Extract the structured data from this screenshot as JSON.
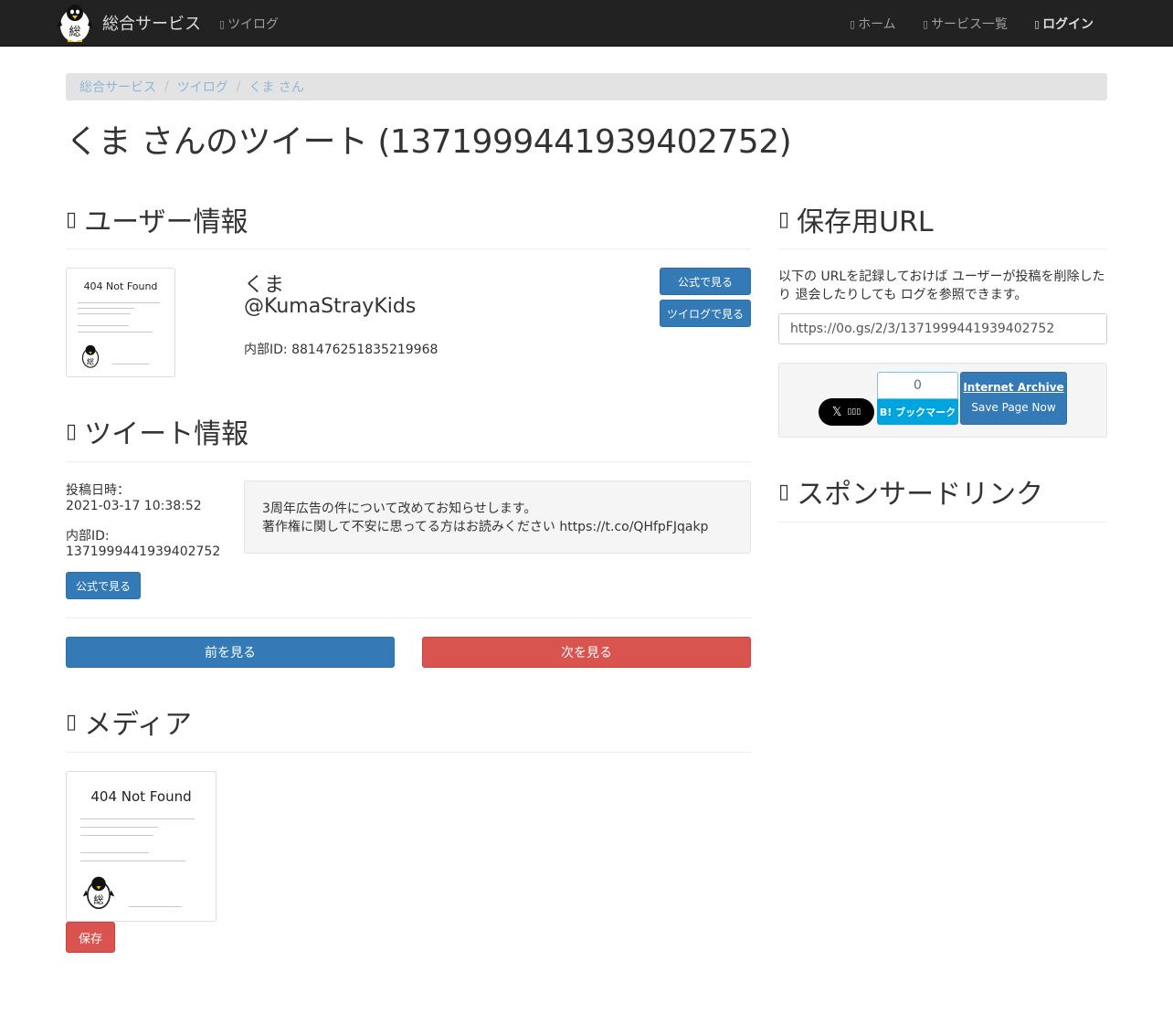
{
  "nav": {
    "brand": "総合サービス",
    "twilog": "ツイログ",
    "home": "ホーム",
    "services": "サービス一覧",
    "login": "ログイン"
  },
  "breadcrumb": [
    "総合サービス",
    "ツイログ",
    "くま さん"
  ],
  "page_title": "くま さんのツイート (1371999441939402752)",
  "user_section": {
    "heading": "ユーザー情報",
    "avatar_title": "404 Not Found",
    "name": "くま",
    "handle": "@KumaStrayKids",
    "internal_id": "内部ID: 881476251835219968",
    "btn_official": "公式で見る",
    "btn_twilog": "ツイログで見る"
  },
  "tweet_section": {
    "heading": "ツイート情報",
    "posted_label": "投稿日時：",
    "posted_value": "2021-03-17 10:38:52",
    "id_label": "内部ID:",
    "id_value": "1371999441939402752",
    "btn_official": "公式で見る",
    "line1": "3周年広告の件について改めてお知らせします。",
    "line2": "著作権に関して不安に思ってる方はお読みください https://t.co/QHfpFJqakp"
  },
  "pager": {
    "prev": "前を見る",
    "next": "次を見る"
  },
  "media_section": {
    "heading": "メディア",
    "image_title": "404 Not Found",
    "save": "保存"
  },
  "archive_section": {
    "heading": "保存用URL",
    "description": "以下の URLを記録しておけば ユーザーが投稿を削除したり 退会したりしても ログを参照できます。",
    "url": "https://0o.gs/2/3/1371999441939402752",
    "hatena_count": "0",
    "hatena_label": "B! ブックマーク",
    "ia_title": "Internet Archive",
    "ia_action": "Save Page Now"
  },
  "sponsor_section": {
    "heading": "スポンサードリンク"
  },
  "icons": {
    "brand": "penguin-logo-icon",
    "nav": "glyphicon-icon",
    "x": "x-logo-icon"
  },
  "colors": {
    "primary": "#337ab7",
    "danger": "#d9534f",
    "navbar": "#222222",
    "hatena": "#00a4de"
  }
}
